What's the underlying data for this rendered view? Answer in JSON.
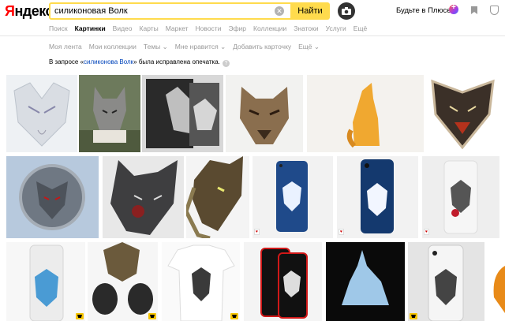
{
  "header": {
    "logo": "Яндекс",
    "search_value": "силиконовая Волк",
    "search_button": "Найти",
    "plus_link": "Будьте в Плюсе"
  },
  "service_tabs": [
    "Поиск",
    "Картинки",
    "Видео",
    "Карты",
    "Маркет",
    "Новости",
    "Эфир",
    "Коллекции",
    "Знатоки",
    "Услуги",
    "Ещё"
  ],
  "active_tab": "Картинки",
  "sub_nav": [
    "Моя лента",
    "Мои коллекции",
    "Темы ⌄",
    "Мне нравится ⌄",
    "Добавить карточку",
    "Ещё ⌄"
  ],
  "correction": {
    "prefix": "В запросе «",
    "corrected": "силиконова Волк",
    "suffix": "» была исправлена опечатка."
  },
  "tiles": [
    {
      "name": "white-wolf-soap-mold",
      "badge": false
    },
    {
      "name": "grey-wolf-figurine",
      "badge": false
    },
    {
      "name": "wolf-head-plaque-grey",
      "badge": false
    },
    {
      "name": "wolf-head-sculpture",
      "badge": false
    },
    {
      "name": "howling-wolf-yellow-candle",
      "badge": false
    },
    {
      "name": "wolf-face-magnet",
      "badge": false
    },
    {
      "name": "silver-wolf-medallion",
      "badge": false
    },
    {
      "name": "wolf-mask-dark",
      "badge": false
    },
    {
      "name": "werewolf-mask-brown",
      "badge": false
    },
    {
      "name": "phone-case-white-wolf-1",
      "badge": true
    },
    {
      "name": "phone-case-white-wolf-2",
      "badge": true
    },
    {
      "name": "phone-case-wolf-rose",
      "badge": true
    },
    {
      "name": "phone-case-blue-wolf",
      "badge": true
    },
    {
      "name": "wolf-paws-gloves",
      "badge": true
    },
    {
      "name": "wolf-print-tshirt",
      "badge": true
    },
    {
      "name": "phone-case-red-wolf",
      "badge": false
    },
    {
      "name": "silicone-wolf-mold-blue",
      "badge": false
    },
    {
      "name": "phone-case-wolf-3",
      "badge": true
    },
    {
      "name": "orange-partial",
      "badge": false
    }
  ]
}
